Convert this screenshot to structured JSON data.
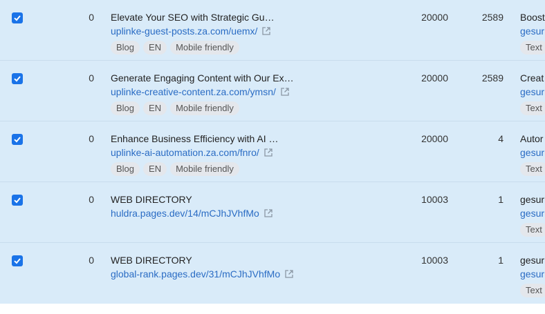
{
  "rows": [
    {
      "checked": true,
      "col0": "0",
      "title": "Elevate Your SEO with Strategic Gu…",
      "url": "uplinke-guest-posts.za.com/uemx/",
      "tags": [
        "Blog",
        "EN",
        "Mobile friendly"
      ],
      "val1": "20000",
      "val2": "2589",
      "c3_title": "Boost",
      "c3_link": "gesur",
      "c3_tag": "Text"
    },
    {
      "checked": true,
      "col0": "0",
      "title": "Generate Engaging Content with Our Ex…",
      "url": "uplinke-creative-content.za.com/ymsn/",
      "tags": [
        "Blog",
        "EN",
        "Mobile friendly"
      ],
      "val1": "20000",
      "val2": "2589",
      "c3_title": "Creat",
      "c3_link": "gesur",
      "c3_tag": "Text"
    },
    {
      "checked": true,
      "col0": "0",
      "title": "Enhance Business Efficiency with AI …",
      "url": "uplinke-ai-automation.za.com/fnro/",
      "tags": [
        "Blog",
        "EN",
        "Mobile friendly"
      ],
      "val1": "20000",
      "val2": "4",
      "c3_title": "Autor",
      "c3_link": "gesur",
      "c3_tag": "Text"
    },
    {
      "checked": true,
      "col0": "0",
      "title": "WEB DIRECTORY",
      "url": "huldra.pages.dev/14/mCJhJVhfMo",
      "tags": [],
      "val1": "10003",
      "val2": "1",
      "c3_title": "gesur",
      "c3_link": "gesur",
      "c3_tag": "Text"
    },
    {
      "checked": true,
      "col0": "0",
      "title": "WEB DIRECTORY",
      "url": "global-rank.pages.dev/31/mCJhJVhfMo",
      "tags": [],
      "val1": "10003",
      "val2": "1",
      "c3_title": "gesur",
      "c3_link": "gesur",
      "c3_tag": "Text"
    }
  ],
  "icons": {
    "checkbox": "checkmark-icon",
    "external": "external-link-icon"
  },
  "colors": {
    "row_selected": "#d9ebf9",
    "checkbox": "#1a73e8",
    "link": "#2a6cc4",
    "tag_bg": "#e4e7ec"
  }
}
